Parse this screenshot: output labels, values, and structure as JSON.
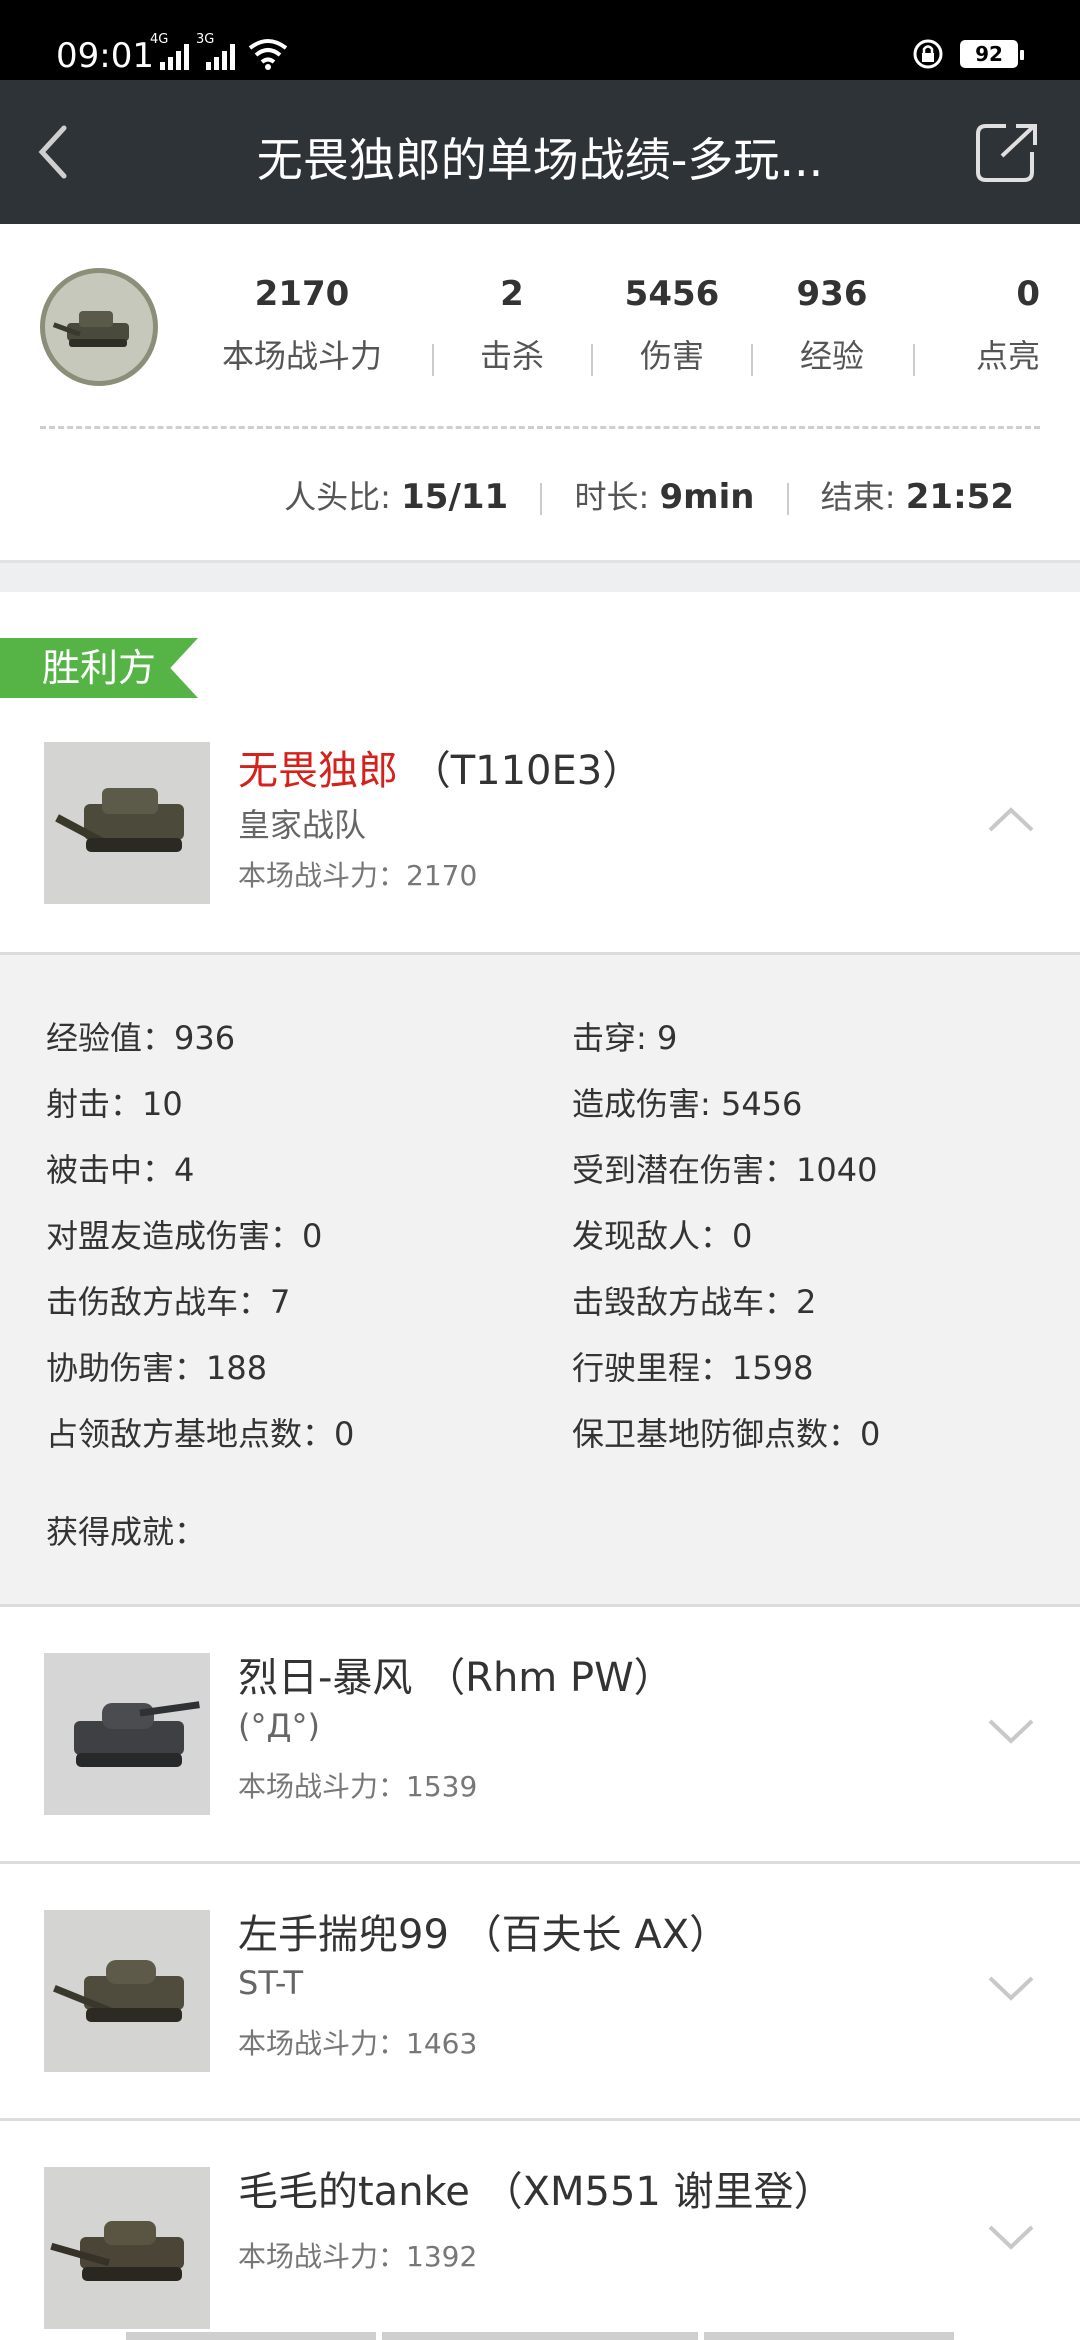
{
  "status_bar": {
    "time": "09:01",
    "signal1": "4G",
    "signal2": "3G",
    "battery": "92"
  },
  "nav": {
    "title": "无畏独郎的单场战绩-多玩..."
  },
  "summary": {
    "stats": [
      {
        "value": "2170",
        "label": "本场战斗力"
      },
      {
        "value": "2",
        "label": "击杀"
      },
      {
        "value": "5456",
        "label": "伤害"
      },
      {
        "value": "936",
        "label": "经验"
      },
      {
        "value": "0",
        "label": "点亮"
      }
    ],
    "ratio_label": "人头比:",
    "ratio_value": "15/11",
    "duration_label": "时长:",
    "duration_value": "9min",
    "end_label": "结束:",
    "end_value": "21:52"
  },
  "victory_label": "胜利方",
  "players": [
    {
      "name": "无畏独郎",
      "tank": "（T110E3）",
      "clan": "皇家战队",
      "power": "本场战斗力：2170",
      "expanded": true
    },
    {
      "name": "烈日-暴风",
      "tank": "（Rhm PW）",
      "clan": "(°Д°)",
      "power": "本场战斗力：1539"
    },
    {
      "name": "左手揣兜99",
      "tank": "（百夫长 AX）",
      "clan": "ST-T",
      "power": "本场战斗力：1463"
    },
    {
      "name": "毛毛的tanke",
      "tank": "（XM551 谢里登）",
      "clan": "",
      "power": "本场战斗力：1392"
    }
  ],
  "details": {
    "left": [
      "经验值：936",
      "射击：10",
      "被击中：4",
      "对盟友造成伤害：0",
      "击伤敌方战车：7",
      "协助伤害：188",
      "占领敌方基地点数：0"
    ],
    "right": [
      "击穿: 9",
      "造成伤害: 5456",
      "受到潜在伤害：1040",
      "发现敌人：0",
      "击毁敌方战车：2",
      "行驶里程：1598",
      "保卫基地防御点数：0"
    ],
    "achievements_label": "获得成就："
  }
}
